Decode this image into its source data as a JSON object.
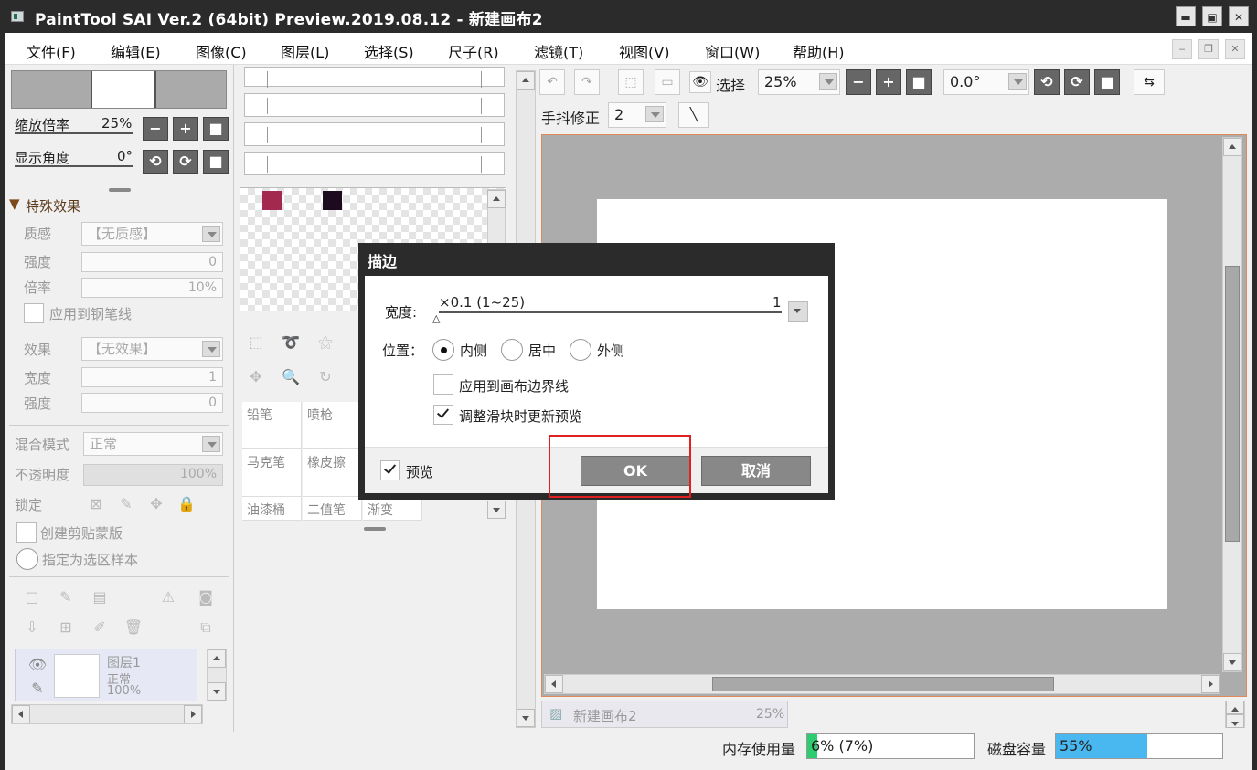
{
  "window": {
    "title": "PaintTool SAI Ver.2 (64bit) Preview.2019.08.12 - 新建画布2",
    "min_label": "▬",
    "max_label": "▣",
    "close_label": "✕"
  },
  "menu": [
    "文件(F)",
    "编辑(E)",
    "图像(C)",
    "图层(L)",
    "选择(S)",
    "尺子(R)",
    "滤镜(T)",
    "视图(V)",
    "窗口(W)",
    "帮助(H)"
  ],
  "navigator": {
    "zoom_label": "缩放倍率",
    "zoom_value": "25%",
    "angle_label": "显示角度",
    "angle_value": "0°"
  },
  "effects": {
    "header": "特殊效果",
    "texture_label": "质感",
    "texture_value": "【无质感】",
    "strength_label": "强度",
    "strength_value": "0",
    "scale_label": "倍率",
    "scale_value": "10%",
    "apply_pen_label": "应用到钢笔线",
    "effect_label": "效果",
    "effect_value": "【无效果】",
    "width_label": "宽度",
    "width_value": "1",
    "strength2_label": "强度",
    "strength2_value": "0"
  },
  "layer_props": {
    "blend_label": "混合模式",
    "blend_value": "正常",
    "opacity_label": "不透明度",
    "opacity_value": "100%",
    "lock_label": "锁定",
    "clip_label": "创建剪贴蒙版",
    "select_src_label": "指定为选区样本"
  },
  "layer": {
    "name": "图层1",
    "mode": "正常",
    "opacity": "100%"
  },
  "swatches": {
    "color_a": "#a3294f",
    "color_b": "#1e0a1e"
  },
  "brushes": {
    "pencil": "铅笔",
    "airbrush": "喷枪",
    "marker": "马克笔",
    "eraser": "橡皮擦",
    "bucket": "油漆桶",
    "binary": "二值笔",
    "gradient": "渐变"
  },
  "canvas_toolbar": {
    "select_label": "选择",
    "zoom_value": "25%",
    "angle_value": "0.0°",
    "stabilizer_label": "手抖修正",
    "stabilizer_value": "2"
  },
  "doc_tab": {
    "name": "新建画布2",
    "zoom": "25%"
  },
  "status": {
    "mem_label": "内存使用量",
    "mem_value": "6% (7%)",
    "mem_fraction": 0.06,
    "disk_label": "磁盘容量",
    "disk_value": "55%",
    "disk_fraction": 0.55
  },
  "dialog": {
    "title": "描边",
    "width_label": "宽度:",
    "width_range": "×0.1 (1~25)",
    "width_value": "1",
    "position_label": "位置：",
    "pos_inner": "内侧",
    "pos_center": "居中",
    "pos_outer": "外侧",
    "apply_border_label": "应用到画布边界线",
    "live_preview_label": "调整滑块时更新预览",
    "preview_label": "预览",
    "ok_label": "OK",
    "cancel_label": "取消"
  },
  "colors": {
    "title_bg": "#2b2b2b",
    "canvas_bg": "#acacac",
    "mem_fill": "#2ecc71",
    "disk_fill": "#4ab8f0",
    "highlight": "#e02020"
  }
}
